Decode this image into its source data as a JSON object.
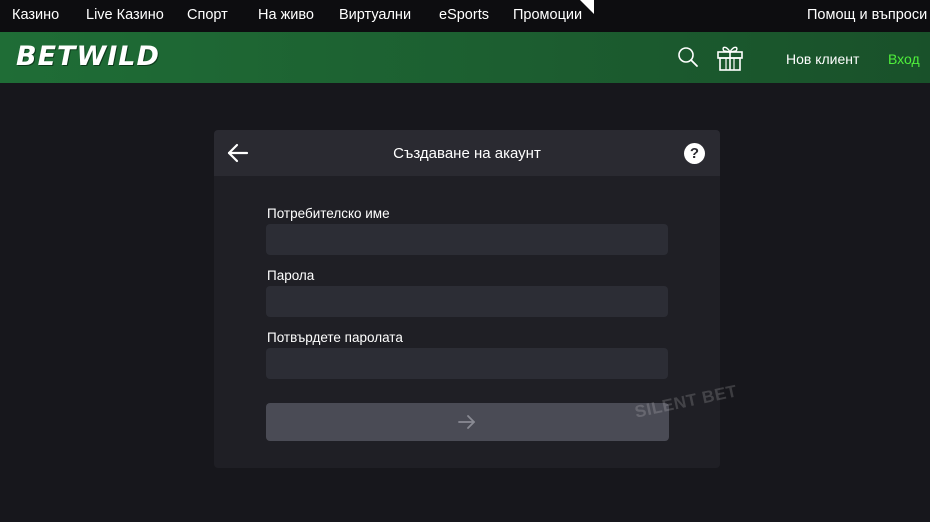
{
  "topnav": {
    "items": [
      {
        "label": "Казино"
      },
      {
        "label": "Live Казино"
      },
      {
        "label": "Спорт"
      },
      {
        "label": "На живо"
      },
      {
        "label": "Виртуални"
      },
      {
        "label": "eSports"
      },
      {
        "label": "Промоции"
      }
    ],
    "help_label": "Помощ и въпроси"
  },
  "header": {
    "logo_text": "BETWILD",
    "search_icon": "search-icon",
    "gift_icon": "gift-icon",
    "new_client_label": "Нов клиент",
    "login_label": "Вход",
    "login_color": "#4ff03b",
    "brand_color": "#1f6d36"
  },
  "modal": {
    "title": "Създаване на акаунт",
    "back_icon": "arrow-left-icon",
    "help_icon_label": "?",
    "fields": [
      {
        "label": "Потребителско име",
        "value": ""
      },
      {
        "label": "Парола",
        "value": ""
      },
      {
        "label": "Потвърдете паролата",
        "value": ""
      }
    ],
    "submit_icon": "arrow-right-icon"
  },
  "watermark": {
    "text": "SILENT BET"
  }
}
